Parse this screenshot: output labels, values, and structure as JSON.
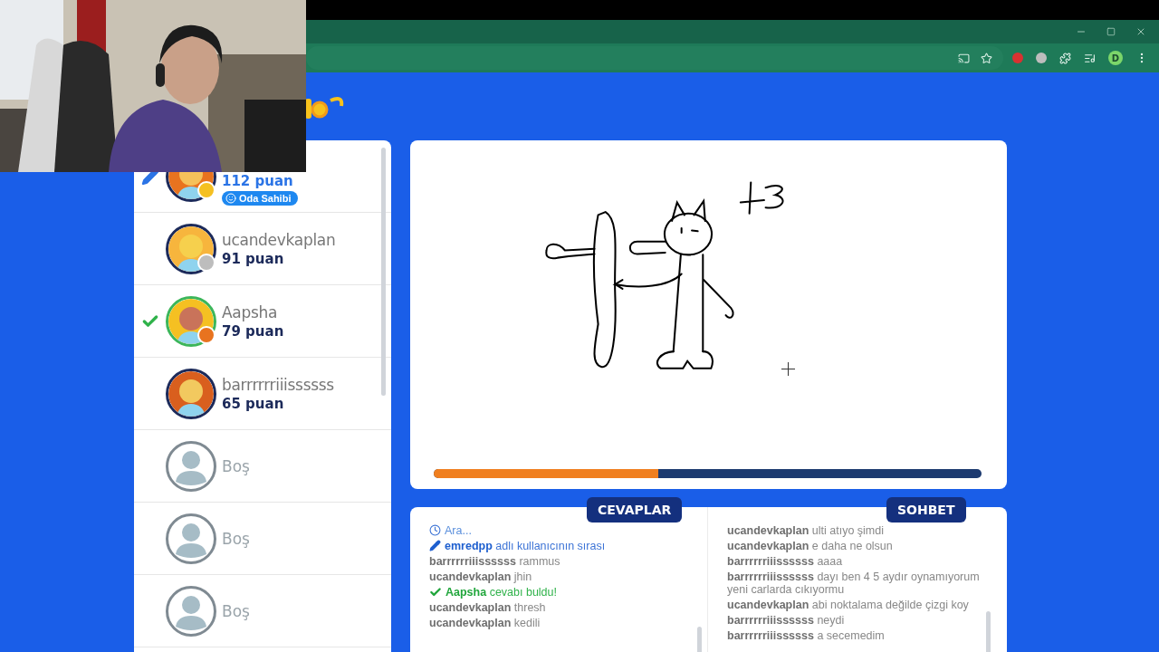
{
  "browser": {
    "profile_initial": "D"
  },
  "players": [
    {
      "kind": "player",
      "score": "112 puan",
      "badge": "Oda Sahibi",
      "drawing": true,
      "guessed": false,
      "color": "#f5c022"
    },
    {
      "kind": "player",
      "name": "ucandevkaplan",
      "score": "91 puan",
      "drawing": false,
      "guessed": false,
      "color": "#bdbdbd"
    },
    {
      "kind": "player",
      "name": "Aapsha",
      "score": "79 puan",
      "drawing": false,
      "guessed": true,
      "color": "#e8731f"
    },
    {
      "kind": "player",
      "name": "barrrrrriiissssss",
      "score": "65 puan",
      "drawing": false,
      "guessed": false
    },
    {
      "kind": "empty",
      "name": "Boş"
    },
    {
      "kind": "empty",
      "name": "Boş"
    },
    {
      "kind": "empty",
      "name": "Boş"
    }
  ],
  "timer": {
    "level": 0.41
  },
  "answers": {
    "title": "CEVAPLAR",
    "lines": [
      {
        "kind": "wait",
        "text": "Ara..."
      },
      {
        "kind": "turn",
        "user": "emredpp",
        "text": "adlı kullanıcının sırası"
      },
      {
        "kind": "message",
        "user": "barrrrrriiissssss",
        "text": "rammus"
      },
      {
        "kind": "message",
        "user": "ucandevkaplan",
        "text": "jhin"
      },
      {
        "kind": "correct",
        "user": "Aapsha",
        "text": "cevabı buldu!"
      },
      {
        "kind": "message",
        "user": "ucandevkaplan",
        "text": "thresh"
      },
      {
        "kind": "message",
        "user": "ucandevkaplan",
        "text": "kedili"
      }
    ]
  },
  "chat": {
    "title": "SOHBET",
    "lines": [
      {
        "kind": "message",
        "user": "ucandevkaplan",
        "text": "ulti atıyo şimdi"
      },
      {
        "kind": "message",
        "user": "ucandevkaplan",
        "text": "e daha ne olsun"
      },
      {
        "kind": "message",
        "user": "barrrrrriiissssss",
        "text": "aaaa"
      },
      {
        "kind": "message",
        "user": "barrrrrriiissssss",
        "text": "dayı ben 4 5 aydır oynamıyorum yeni carlarda cıkıyormu"
      },
      {
        "kind": "message",
        "user": "ucandevkaplan",
        "text": "abi noktalama değilde çizgi koy"
      },
      {
        "kind": "message",
        "user": "barrrrrriiissssss",
        "text": "neydi"
      },
      {
        "kind": "message",
        "user": "barrrrrriiissssss",
        "text": "a secemedim"
      }
    ]
  }
}
